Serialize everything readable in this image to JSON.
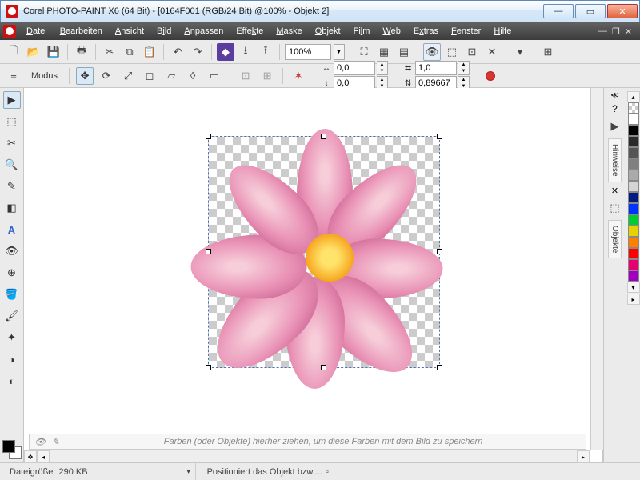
{
  "window": {
    "title": "Corel PHOTO-PAINT X6 (64 Bit) - [0164F001 (RGB/24 Bit) @100% - Objekt 2]"
  },
  "menu": {
    "items": [
      "Datei",
      "Bearbeiten",
      "Ansicht",
      "Bild",
      "Anpassen",
      "Effekte",
      "Maske",
      "Objekt",
      "Film",
      "Web",
      "Extras",
      "Fenster",
      "Hilfe"
    ]
  },
  "toolbar": {
    "zoom_value": "100%"
  },
  "propbar": {
    "modus_label": "Modus",
    "pos_x": "0,0",
    "pos_y": "0,0",
    "scale_x": "1,0",
    "scale_y": "0,89667"
  },
  "right_tabs": {
    "hints": "Hinweise",
    "objects": "Objekte"
  },
  "palette_colors": [
    "#ffffff",
    "#000000",
    "#2a2a2a",
    "#555555",
    "#808080",
    "#aaaaaa",
    "#d4d4d4",
    "#001a80",
    "#0033ff",
    "#00cc33",
    "#e6d200",
    "#ff8000",
    "#ff0000",
    "#e60073",
    "#a000c0"
  ],
  "hint": "Farben (oder Objekte) hierher ziehen, um diese Farben mit dem Bild zu speichern",
  "status": {
    "filesize_label": "Dateigröße:",
    "filesize_value": "290 KB",
    "action": "Positioniert das Objekt bzw...."
  }
}
